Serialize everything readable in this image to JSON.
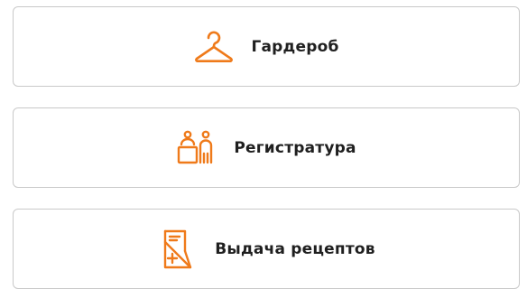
{
  "accent_color": "#ef7a1a",
  "menu": {
    "items": [
      {
        "label": "Гардероб",
        "icon": "hanger-icon"
      },
      {
        "label": "Регистратура",
        "icon": "reception-icon"
      },
      {
        "label": "Выдача рецептов",
        "icon": "prescription-icon"
      }
    ]
  }
}
